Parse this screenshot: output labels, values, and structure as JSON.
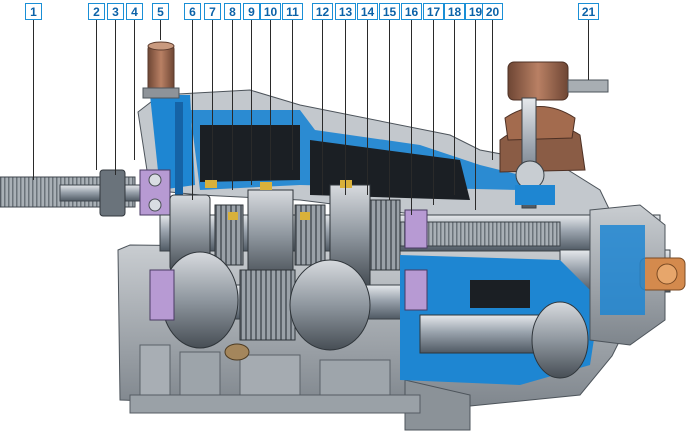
{
  "diagram": {
    "callouts": [
      "1",
      "2",
      "3",
      "4",
      "5",
      "6",
      "7",
      "8",
      "9",
      "10",
      "11",
      "12",
      "13",
      "14",
      "15",
      "16",
      "17",
      "18",
      "19",
      "20",
      "21"
    ]
  },
  "colors": {
    "housing_blue": "#1e86d2",
    "shaft_grey": "#9aa3ad",
    "gear_grey": "#b7bcc2",
    "dark_interior": "#1b1f24",
    "bronze_synchro": "#d9b13a",
    "bearing_lilac": "#b79ad3",
    "brown_knob": "#9c6a4f",
    "label_border": "#1a8fd6",
    "label_text": "#0c62a8"
  }
}
